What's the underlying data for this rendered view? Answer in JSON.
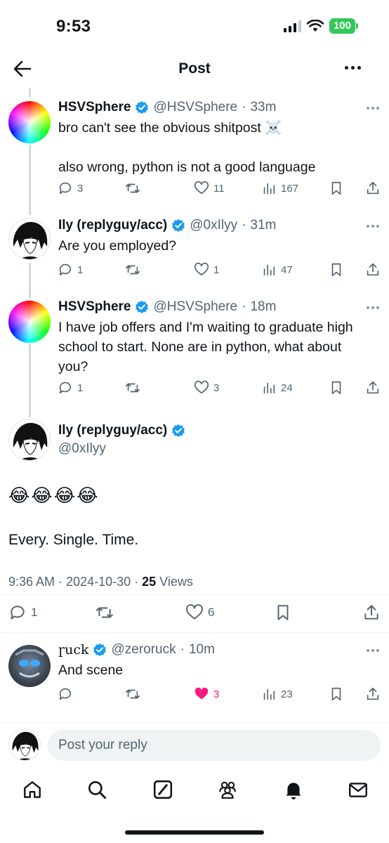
{
  "status_bar": {
    "time": "9:53",
    "battery": "100"
  },
  "header": {
    "title": "Post"
  },
  "tweets": [
    {
      "name": "HSVSphere",
      "handle": "@HSVSphere",
      "time": "33m",
      "text": [
        "bro can't see the obvious shitpost ☠️",
        "also wrong, python is not a good language"
      ],
      "replies": "3",
      "reposts": "",
      "likes": "11",
      "views": "167"
    },
    {
      "name": "Ily (replyguy/acc)",
      "handle": "@0xIlyy",
      "time": "31m",
      "text": [
        "Are you employed?"
      ],
      "replies": "1",
      "reposts": "",
      "likes": "1",
      "views": "47"
    },
    {
      "name": "HSVSphere",
      "handle": "@HSVSphere",
      "time": "18m",
      "text": [
        "I have job offers and I'm waiting to graduate high school to start. None are in python, what about you?"
      ],
      "replies": "1",
      "reposts": "",
      "likes": "3",
      "views": "24"
    }
  ],
  "main_post": {
    "name": "Ily (replyguy/acc)",
    "handle": "@0xIlyy",
    "emojis": "😂😂😂😂",
    "text": "Every. Single. Time.",
    "timestamp": "9:36 AM · 2024-10-30 · ",
    "views_count": "25",
    "views_label": " Views",
    "replies": "1",
    "likes": "6"
  },
  "reply": {
    "name": "ɼuck",
    "handle": "@zeroruck",
    "time": "10m",
    "text": "And scene",
    "replies": "",
    "likes": "3",
    "views": "23"
  },
  "composer": {
    "placeholder": "Post your reply"
  },
  "colors": {
    "verified": "#1d9bf0",
    "like_active": "#f91880",
    "secondary_text": "#536471",
    "battery": "#34c759"
  },
  "nav": [
    "home-icon",
    "search-icon",
    "grok-icon",
    "communities-icon",
    "notifications-icon",
    "messages-icon"
  ]
}
